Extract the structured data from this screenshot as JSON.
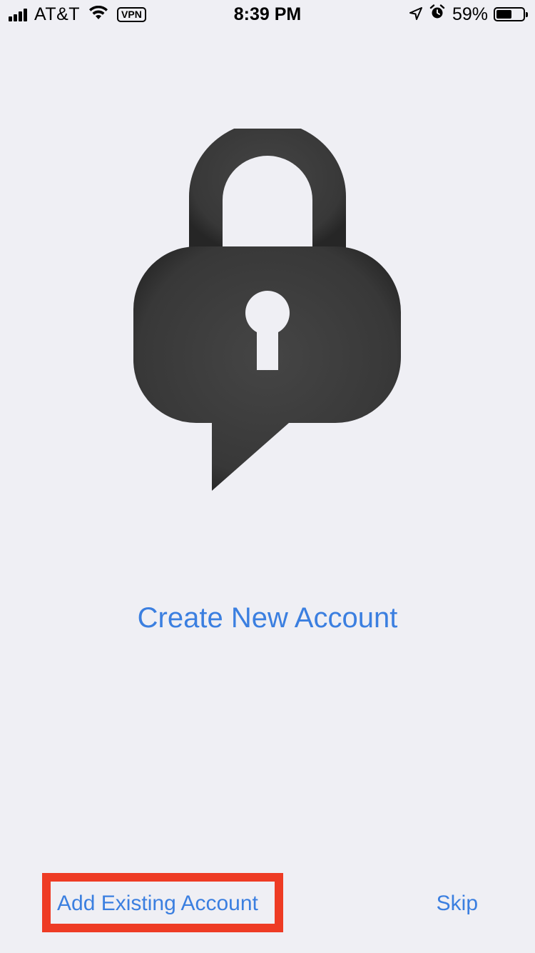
{
  "status_bar": {
    "carrier": "AT&T",
    "vpn": "VPN",
    "time": "8:39 PM",
    "battery_percent": "59%",
    "battery_level": 0.59,
    "icons": [
      "signal-icon",
      "wifi-icon",
      "location-icon",
      "alarm-icon",
      "battery-icon"
    ]
  },
  "logo": {
    "icon": "chat-lock-icon",
    "color": "#3a3a3a"
  },
  "actions": {
    "create_new_account": "Create New Account",
    "add_existing_account": "Add Existing Account",
    "skip": "Skip"
  },
  "colors": {
    "accent": "#3b7fe0",
    "background": "#efeff4",
    "highlight": "#ee3b24"
  }
}
